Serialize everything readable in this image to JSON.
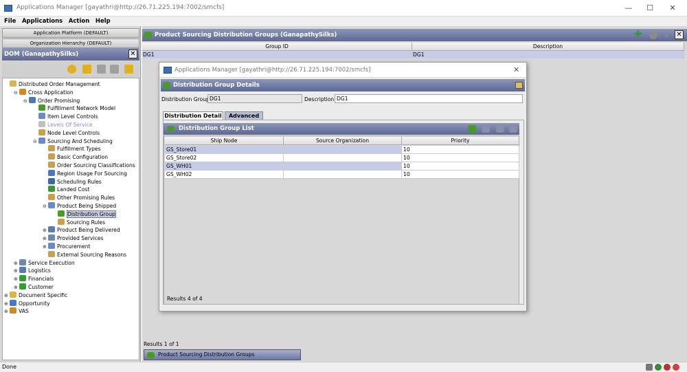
{
  "window": {
    "title": "Applications Manager [gayathri@http://26.71.225.194:7002/smcfs]",
    "minimize": "—",
    "maximize": "☐",
    "close": "✕"
  },
  "menu": [
    "File",
    "Applications",
    "Action",
    "Help"
  ],
  "left": {
    "context_buttons": [
      "Application Platform (DEFAULT)",
      "Organization Hierarchy (DEFAULT)"
    ],
    "header": "DOM (GanapathySilks)",
    "tree": [
      {
        "label": "Distributed Order Management",
        "level": 0,
        "expander": "",
        "icon": "folder-icon"
      },
      {
        "label": "Cross Application",
        "level": 1,
        "expander": "⊖",
        "icon": "tools-icon"
      },
      {
        "label": "Order Promising",
        "level": 2,
        "expander": "⊖",
        "icon": "globe-icon"
      },
      {
        "label": "Fulfillment Network Model",
        "level": 3,
        "expander": "",
        "icon": "network-icon"
      },
      {
        "label": "Item Level Controls",
        "level": 3,
        "expander": "",
        "icon": "box-icon"
      },
      {
        "label": "Levels Of Service",
        "level": 3,
        "expander": "",
        "icon": "disabled-icon",
        "disabled": true
      },
      {
        "label": "Node Level Controls",
        "level": 3,
        "expander": "",
        "icon": "link-icon"
      },
      {
        "label": "Sourcing And Scheduling",
        "level": 3,
        "expander": "⊖",
        "icon": "box-icon"
      },
      {
        "label": "Fulfillment Types",
        "level": 4,
        "expander": "",
        "icon": "list-icon"
      },
      {
        "label": "Basic Configuration",
        "level": 4,
        "expander": "",
        "icon": "list-icon"
      },
      {
        "label": "Order Sourcing Classifications",
        "level": 4,
        "expander": "",
        "icon": "list-icon"
      },
      {
        "label": "Region Usage For Sourcing",
        "level": 4,
        "expander": "",
        "icon": "globe-icon"
      },
      {
        "label": "Scheduling Rules",
        "level": 4,
        "expander": "",
        "icon": "schedule-icon"
      },
      {
        "label": "Landed Cost",
        "level": 4,
        "expander": "",
        "icon": "cost-icon"
      },
      {
        "label": "Other Promising Rules",
        "level": 4,
        "expander": "",
        "icon": "rules-icon"
      },
      {
        "label": "Product Being Shipped",
        "level": 4,
        "expander": "⊖",
        "icon": "box-icon"
      },
      {
        "label": "Distribution Group",
        "level": 5,
        "expander": "",
        "icon": "network-icon",
        "selected": true
      },
      {
        "label": "Sourcing Rules",
        "level": 5,
        "expander": "",
        "icon": "rules-icon"
      },
      {
        "label": "Product Being Delivered",
        "level": 4,
        "expander": "⊕",
        "icon": "truck-icon"
      },
      {
        "label": "Provided Services",
        "level": 4,
        "expander": "⊕",
        "icon": "service-icon"
      },
      {
        "label": "Procurement",
        "level": 4,
        "expander": "⊕",
        "icon": "box-icon"
      },
      {
        "label": "External Sourcing Reasons",
        "level": 4,
        "expander": "",
        "icon": "list-icon"
      },
      {
        "label": "Service Execution",
        "level": 1,
        "expander": "⊕",
        "icon": "service-icon"
      },
      {
        "label": "Logistics",
        "level": 1,
        "expander": "⊕",
        "icon": "truck-icon"
      },
      {
        "label": "Financials",
        "level": 1,
        "expander": "⊕",
        "icon": "cost-icon"
      },
      {
        "label": "Customer",
        "level": 1,
        "expander": "⊕",
        "icon": "people-icon"
      },
      {
        "label": "Document Specific",
        "level": 0,
        "expander": "⊕",
        "icon": "folder-icon"
      },
      {
        "label": "Opportunity",
        "level": 0,
        "expander": "⊕",
        "icon": "globe-icon"
      },
      {
        "label": "VAS",
        "level": 0,
        "expander": "⊕",
        "icon": "tools-icon"
      }
    ]
  },
  "main": {
    "header": "Product Sourcing Distribution Groups (GanapathySilks)",
    "columns": [
      "Group ID",
      "Description"
    ],
    "rows": [
      [
        "DG1",
        "DG1"
      ]
    ],
    "results": "Results  1  of  1",
    "task_tab": "Product Sourcing Distribution Groups (GanapathySilks)"
  },
  "dialog": {
    "title": "Applications Manager [gayathri@http://26.71.225.194:7002/smcfs]",
    "header": "Distribution Group Details",
    "group_label": "Distribution Group",
    "group_value": "DG1",
    "desc_label": "Description",
    "desc_value": "DG1",
    "tabs": [
      "Distribution Detail",
      "Advanced"
    ],
    "list_header": "Distribution Group List",
    "list_columns": [
      "Ship Node",
      "Source Organization",
      "Priority"
    ],
    "list_rows": [
      [
        "GS_Store01",
        "",
        "10"
      ],
      [
        "GS_Store02",
        "",
        "10"
      ],
      [
        "GS_WH01",
        "",
        "10"
      ],
      [
        "GS_WH02",
        "",
        "10"
      ]
    ],
    "results": "Results  4  of  4"
  },
  "status": {
    "text": "Done"
  }
}
